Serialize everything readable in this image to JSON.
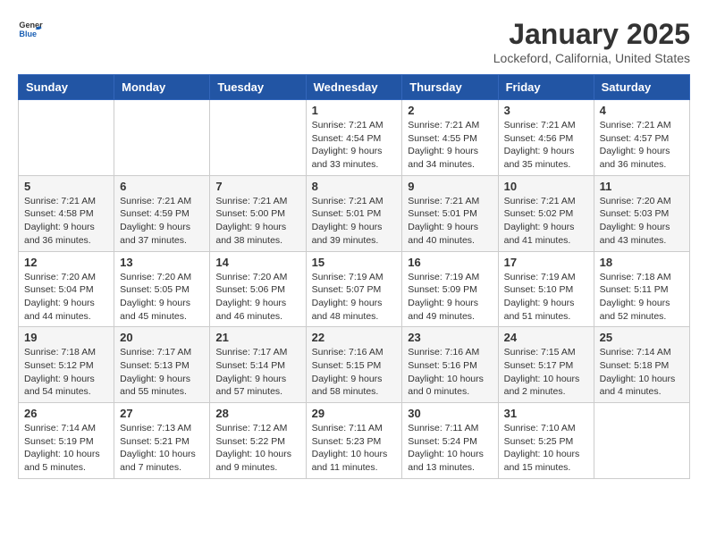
{
  "header": {
    "logo_general": "General",
    "logo_blue": "Blue",
    "title": "January 2025",
    "subtitle": "Lockeford, California, United States"
  },
  "weekdays": [
    "Sunday",
    "Monday",
    "Tuesday",
    "Wednesday",
    "Thursday",
    "Friday",
    "Saturday"
  ],
  "weeks": [
    [
      {
        "day": "",
        "info": ""
      },
      {
        "day": "",
        "info": ""
      },
      {
        "day": "",
        "info": ""
      },
      {
        "day": "1",
        "info": "Sunrise: 7:21 AM\nSunset: 4:54 PM\nDaylight: 9 hours\nand 33 minutes."
      },
      {
        "day": "2",
        "info": "Sunrise: 7:21 AM\nSunset: 4:55 PM\nDaylight: 9 hours\nand 34 minutes."
      },
      {
        "day": "3",
        "info": "Sunrise: 7:21 AM\nSunset: 4:56 PM\nDaylight: 9 hours\nand 35 minutes."
      },
      {
        "day": "4",
        "info": "Sunrise: 7:21 AM\nSunset: 4:57 PM\nDaylight: 9 hours\nand 36 minutes."
      }
    ],
    [
      {
        "day": "5",
        "info": "Sunrise: 7:21 AM\nSunset: 4:58 PM\nDaylight: 9 hours\nand 36 minutes."
      },
      {
        "day": "6",
        "info": "Sunrise: 7:21 AM\nSunset: 4:59 PM\nDaylight: 9 hours\nand 37 minutes."
      },
      {
        "day": "7",
        "info": "Sunrise: 7:21 AM\nSunset: 5:00 PM\nDaylight: 9 hours\nand 38 minutes."
      },
      {
        "day": "8",
        "info": "Sunrise: 7:21 AM\nSunset: 5:01 PM\nDaylight: 9 hours\nand 39 minutes."
      },
      {
        "day": "9",
        "info": "Sunrise: 7:21 AM\nSunset: 5:01 PM\nDaylight: 9 hours\nand 40 minutes."
      },
      {
        "day": "10",
        "info": "Sunrise: 7:21 AM\nSunset: 5:02 PM\nDaylight: 9 hours\nand 41 minutes."
      },
      {
        "day": "11",
        "info": "Sunrise: 7:20 AM\nSunset: 5:03 PM\nDaylight: 9 hours\nand 43 minutes."
      }
    ],
    [
      {
        "day": "12",
        "info": "Sunrise: 7:20 AM\nSunset: 5:04 PM\nDaylight: 9 hours\nand 44 minutes."
      },
      {
        "day": "13",
        "info": "Sunrise: 7:20 AM\nSunset: 5:05 PM\nDaylight: 9 hours\nand 45 minutes."
      },
      {
        "day": "14",
        "info": "Sunrise: 7:20 AM\nSunset: 5:06 PM\nDaylight: 9 hours\nand 46 minutes."
      },
      {
        "day": "15",
        "info": "Sunrise: 7:19 AM\nSunset: 5:07 PM\nDaylight: 9 hours\nand 48 minutes."
      },
      {
        "day": "16",
        "info": "Sunrise: 7:19 AM\nSunset: 5:09 PM\nDaylight: 9 hours\nand 49 minutes."
      },
      {
        "day": "17",
        "info": "Sunrise: 7:19 AM\nSunset: 5:10 PM\nDaylight: 9 hours\nand 51 minutes."
      },
      {
        "day": "18",
        "info": "Sunrise: 7:18 AM\nSunset: 5:11 PM\nDaylight: 9 hours\nand 52 minutes."
      }
    ],
    [
      {
        "day": "19",
        "info": "Sunrise: 7:18 AM\nSunset: 5:12 PM\nDaylight: 9 hours\nand 54 minutes."
      },
      {
        "day": "20",
        "info": "Sunrise: 7:17 AM\nSunset: 5:13 PM\nDaylight: 9 hours\nand 55 minutes."
      },
      {
        "day": "21",
        "info": "Sunrise: 7:17 AM\nSunset: 5:14 PM\nDaylight: 9 hours\nand 57 minutes."
      },
      {
        "day": "22",
        "info": "Sunrise: 7:16 AM\nSunset: 5:15 PM\nDaylight: 9 hours\nand 58 minutes."
      },
      {
        "day": "23",
        "info": "Sunrise: 7:16 AM\nSunset: 5:16 PM\nDaylight: 10 hours\nand 0 minutes."
      },
      {
        "day": "24",
        "info": "Sunrise: 7:15 AM\nSunset: 5:17 PM\nDaylight: 10 hours\nand 2 minutes."
      },
      {
        "day": "25",
        "info": "Sunrise: 7:14 AM\nSunset: 5:18 PM\nDaylight: 10 hours\nand 4 minutes."
      }
    ],
    [
      {
        "day": "26",
        "info": "Sunrise: 7:14 AM\nSunset: 5:19 PM\nDaylight: 10 hours\nand 5 minutes."
      },
      {
        "day": "27",
        "info": "Sunrise: 7:13 AM\nSunset: 5:21 PM\nDaylight: 10 hours\nand 7 minutes."
      },
      {
        "day": "28",
        "info": "Sunrise: 7:12 AM\nSunset: 5:22 PM\nDaylight: 10 hours\nand 9 minutes."
      },
      {
        "day": "29",
        "info": "Sunrise: 7:11 AM\nSunset: 5:23 PM\nDaylight: 10 hours\nand 11 minutes."
      },
      {
        "day": "30",
        "info": "Sunrise: 7:11 AM\nSunset: 5:24 PM\nDaylight: 10 hours\nand 13 minutes."
      },
      {
        "day": "31",
        "info": "Sunrise: 7:10 AM\nSunset: 5:25 PM\nDaylight: 10 hours\nand 15 minutes."
      },
      {
        "day": "",
        "info": ""
      }
    ]
  ]
}
